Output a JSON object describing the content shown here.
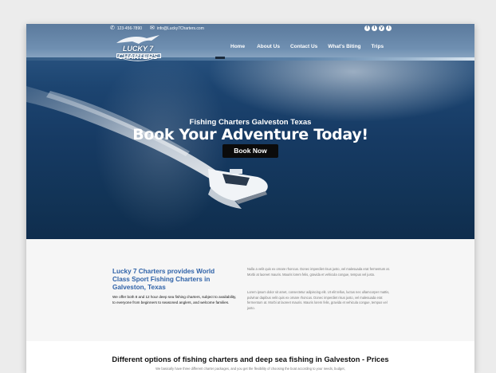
{
  "topbar": {
    "phone": "123-456-7890",
    "email": "info@Lucky7Charters.com",
    "social": [
      "f",
      "t",
      "y",
      "i"
    ]
  },
  "logo": {
    "name": "LUCKY 7 CHARTERS",
    "tagline": "GALVESTON TEXAS"
  },
  "nav": {
    "items": [
      "Home",
      "About Us",
      "Contact Us",
      "What's Biting",
      "Trips"
    ]
  },
  "hero": {
    "subtitle": "Fishing Charters Galveston Texas",
    "title": "Book Your Adventure Today!",
    "button": "Book Now"
  },
  "intro": {
    "title": "Lucky 7 Charters provides World Class Sport Fishing Charters in Galveston, Texas",
    "text": "We offer both 8 and 12 hour deep sea fishing charters, subject to availability, to everyone from beginners to seasoned anglers, and welcome families.",
    "lorem1": "Nulla a velit quis ex ornare rhoncus. Donec imperdiet risus justo, vel malesuada erat fermentum at. Morbi at laoreet mauris. Mauris lorem felis, gravida et vehicula congue, tempus vel justo.",
    "lorem2": "Lorem ipsum dolor sit amet, consectetur adipiscing elit. Ut elit tellus, luctus nec ullamcorper mattis, pulvinar dapibus velit quis ex ornare rhoncus. Donec imperdiet risus justo, vel malesuada erat fermentum at. Morbi at laoreet mauris. Mauris lorem felis, gravida et vehicula congue, tempus vel justo."
  },
  "prices": {
    "title": "Different options of fishing charters and deep sea fishing in Galveston - Prices",
    "subtitle": "We basically have three different charter packages, and you get the flexibility of choosing the boat according to your needs, budget,"
  },
  "colors": {
    "accent_blue": "#2f62a8",
    "ocean": "#163a63",
    "button_bg": "#0b0b0b"
  }
}
